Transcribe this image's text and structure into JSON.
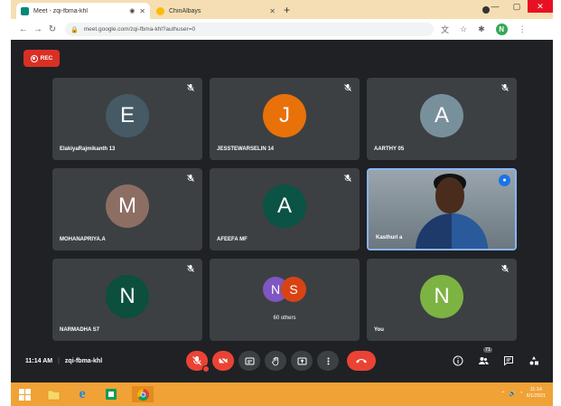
{
  "browser": {
    "tabs": [
      {
        "title": "Meet - zqi-fbma-khl",
        "aux": "◉",
        "active": true
      },
      {
        "title": "ChinAlbays",
        "active": false
      }
    ],
    "url": "meet.google.com/zqi-fbma-khl?authuser=0",
    "profile_initial": "N"
  },
  "meet": {
    "rec_label": "REC",
    "tiles": [
      {
        "name": "ElakiyaRajmikanth 13",
        "initial": "E",
        "color": "#455a64",
        "mic_muted": true
      },
      {
        "name": "JESSTEWARSELIN 14",
        "initial": "J",
        "color": "#e8710a",
        "mic_muted": true
      },
      {
        "name": "AARTHY 05",
        "initial": "A",
        "color": "#78909c",
        "mic_muted": true
      },
      {
        "name": "MOHANAPRIYA.A",
        "initial": "M",
        "color": "#8d6e63",
        "mic_muted": true
      },
      {
        "name": "AFEEFA MF",
        "initial": "A",
        "color": "#0b5345",
        "mic_muted": true
      },
      {
        "name": "Kasthuri a",
        "video": true,
        "speaking": true
      },
      {
        "name": "NARMADHA S7",
        "initial": "N",
        "color": "#0b4f3c",
        "mic_muted": true
      },
      {
        "others": true,
        "label": "60 others",
        "initials": [
          "N",
          "S"
        ],
        "colors": [
          "#7e57c2",
          "#d84315"
        ]
      },
      {
        "name": "You",
        "initial": "N",
        "color": "#7cb342",
        "mic_muted": true
      }
    ],
    "time": "11:14 AM",
    "separator": "|",
    "meeting_code": "zqi-fbma-khl",
    "participant_count": "71"
  },
  "taskbar": {
    "clock_time": "11:14",
    "clock_date": "6/1/2021"
  },
  "colors": {
    "meet_bg": "#202124",
    "tile_bg": "#3c4043",
    "red": "#ea4335",
    "taskbar": "#f0a236"
  }
}
